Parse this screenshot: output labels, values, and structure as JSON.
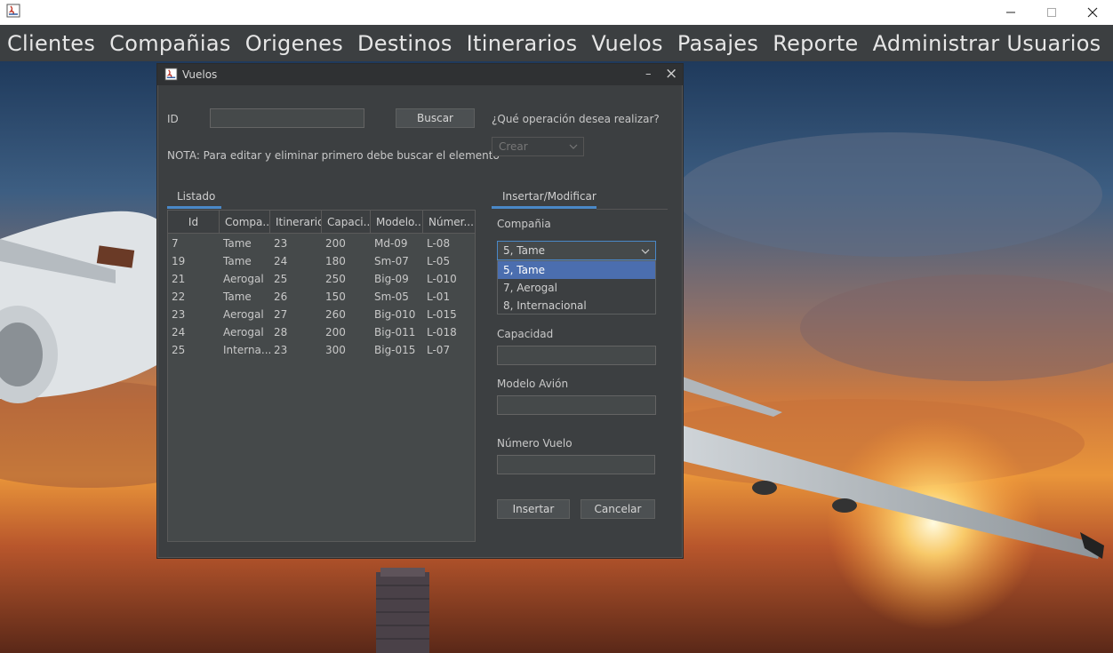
{
  "window": {
    "minimize": "—",
    "maximize": "☐",
    "close": "✕"
  },
  "menu": [
    "Clientes",
    "Compañias",
    "Origenes",
    "Destinos",
    "Itinerarios",
    "Vuelos",
    "Pasajes",
    "Reporte",
    "Administrar Usuarios"
  ],
  "frame": {
    "title": "Vuelos",
    "minimize": "–",
    "close": "×"
  },
  "search": {
    "id_label": "ID",
    "id_value": "",
    "search_button": "Buscar",
    "note": "NOTA: Para editar y eliminar primero debe buscar el elemento"
  },
  "operation": {
    "question": "¿Qué operación desea realizar?",
    "selected": "Crear"
  },
  "tabs": {
    "list": "Listado",
    "form": "Insertar/Modificar"
  },
  "table": {
    "columns": [
      "Id",
      "Compa...",
      "Itinerario",
      "Capaci...",
      "Modelo...",
      "Númer..."
    ],
    "rows": [
      [
        "7",
        "Tame",
        "23",
        "200",
        "Md-09",
        "L-08"
      ],
      [
        "19",
        "Tame",
        "24",
        "180",
        "Sm-07",
        "L-05"
      ],
      [
        "21",
        "Aerogal",
        "25",
        "250",
        "Big-09",
        "L-010"
      ],
      [
        "22",
        "Tame",
        "26",
        "150",
        "Sm-05",
        "L-01"
      ],
      [
        "23",
        "Aerogal",
        "27",
        "260",
        "Big-010",
        "L-015"
      ],
      [
        "24",
        "Aerogal",
        "28",
        "200",
        "Big-011",
        "L-018"
      ],
      [
        "25",
        "Interna...",
        "23",
        "300",
        "Big-015",
        "L-07"
      ]
    ]
  },
  "form": {
    "company_label": "Compañia",
    "company_selected": "5, Tame",
    "company_options": [
      "5, Tame",
      "7, Aerogal",
      "8, Internacional"
    ],
    "capacity_label": "Capacidad",
    "capacity_value": "",
    "model_label": "Modelo Avión",
    "model_value": "",
    "flight_label": "Número Vuelo",
    "flight_value": "",
    "insert_button": "Insertar",
    "cancel_button": "Cancelar"
  }
}
